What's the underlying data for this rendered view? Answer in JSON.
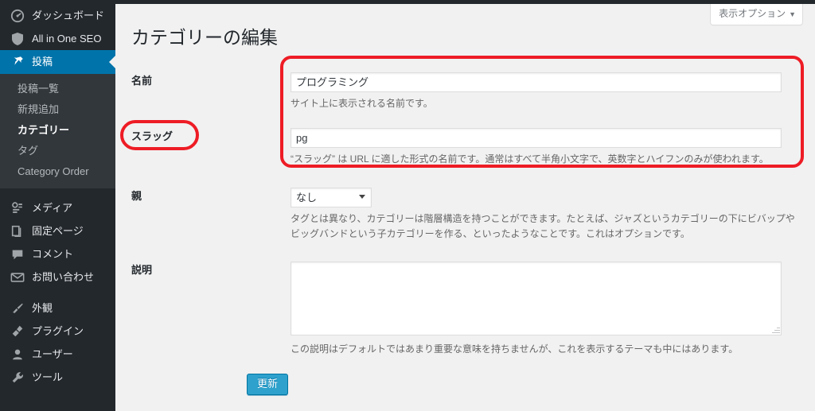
{
  "sidebar": {
    "items": [
      {
        "label": "ダッシュボード",
        "icon": "dashboard-icon",
        "active": false
      },
      {
        "label": "All in One SEO",
        "icon": "shield-icon",
        "active": false
      },
      {
        "label": "投稿",
        "icon": "pin-icon",
        "active": true
      },
      {
        "label": "メディア",
        "icon": "media-icon",
        "active": false
      },
      {
        "label": "固定ページ",
        "icon": "page-icon",
        "active": false
      },
      {
        "label": "コメント",
        "icon": "comment-icon",
        "active": false
      },
      {
        "label": "お問い合わせ",
        "icon": "envelope-icon",
        "active": false
      },
      {
        "label": "外観",
        "icon": "paintbrush-icon",
        "active": false
      },
      {
        "label": "プラグイン",
        "icon": "plug-icon",
        "active": false
      },
      {
        "label": "ユーザー",
        "icon": "user-icon",
        "active": false
      },
      {
        "label": "ツール",
        "icon": "wrench-icon",
        "active": false
      }
    ],
    "submenu": [
      {
        "label": "投稿一覧",
        "current": false
      },
      {
        "label": "新規追加",
        "current": false
      },
      {
        "label": "カテゴリー",
        "current": true
      },
      {
        "label": "タグ",
        "current": false
      },
      {
        "label": "Category Order",
        "current": false
      }
    ]
  },
  "screen_meta": {
    "show_settings_label": "表示オプション",
    "caret": "▼"
  },
  "page": {
    "title": "カテゴリーの編集"
  },
  "form": {
    "name": {
      "label": "名前",
      "value": "プログラミング",
      "description": "サイト上に表示される名前です。"
    },
    "slug": {
      "label": "スラッグ",
      "value": "pg",
      "description": "“スラッグ” は URL に適した形式の名前です。通常はすべて半角小文字で、英数字とハイフンのみが使われます。"
    },
    "parent": {
      "label": "親",
      "selected": "なし",
      "options": [
        "なし"
      ],
      "description": "タグとは異なり、カテゴリーは階層構造を持つことができます。たとえば、ジャズというカテゴリーの下にビバップやビッグバンドという子カテゴリーを作る、といったようなことです。これはオプションです。"
    },
    "description": {
      "label": "説明",
      "value": "",
      "description": "この説明はデフォルトではあまり重要な意味を持ちませんが、これを表示するテーマも中にはあります。"
    },
    "submit_label": "更新"
  },
  "annotations": {
    "accent_color": "#ee1c25",
    "highlight_fields": "name-and-slug-fields",
    "highlight_label": "slug-label"
  },
  "colors": {
    "sidebar_bg": "#23282d",
    "submenu_bg": "#32373c",
    "active_blue": "#0073aa",
    "button_blue": "#2ea2cc",
    "content_bg": "#f1f1f1"
  }
}
